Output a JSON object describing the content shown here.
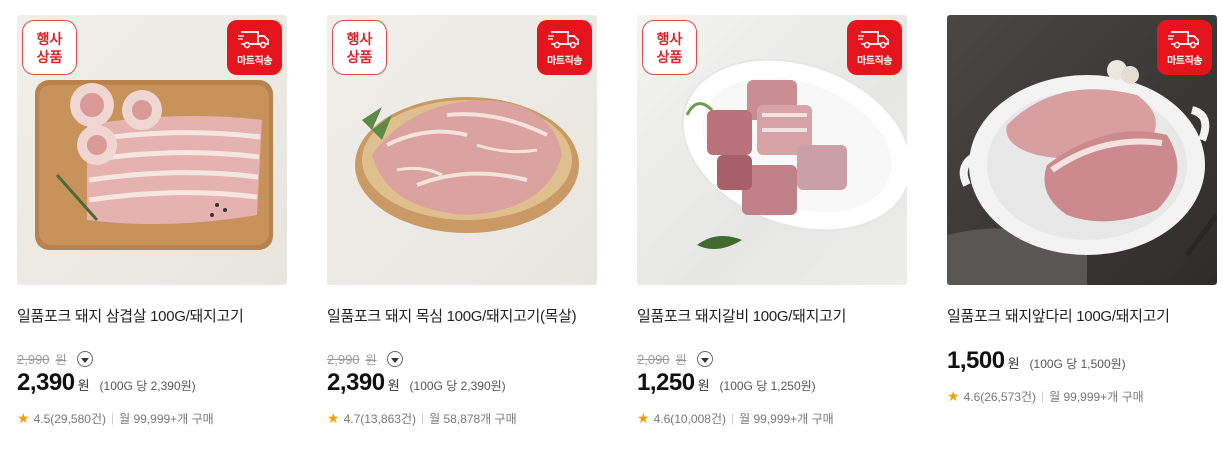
{
  "products": [
    {
      "event_badge": [
        "행사",
        "상품"
      ],
      "delivery_badge": "마트직송",
      "name": "일품포크 돼지 삼겹살 100G/돼지고기",
      "original_price": "2,990",
      "original_unit": "원",
      "price": "2,390",
      "price_unit": "원",
      "unit_price": "(100G 당 2,390원)",
      "rating": "4.5(29,580건)",
      "purchases": "월 99,999+개 구매"
    },
    {
      "event_badge": [
        "행사",
        "상품"
      ],
      "delivery_badge": "마트직송",
      "name": "일품포크 돼지 목심 100G/돼지고기(목살)",
      "original_price": "2,990",
      "original_unit": "원",
      "price": "2,390",
      "price_unit": "원",
      "unit_price": "(100G 당 2,390원)",
      "rating": "4.7(13,863건)",
      "purchases": "월 58,878개 구매"
    },
    {
      "event_badge": [
        "행사",
        "상품"
      ],
      "delivery_badge": "마트직송",
      "name": "일품포크 돼지갈비 100G/돼지고기",
      "original_price": "2,090",
      "original_unit": "원",
      "price": "1,250",
      "price_unit": "원",
      "unit_price": "(100G 당 1,250원)",
      "rating": "4.6(10,008건)",
      "purchases": "월 99,999+개 구매"
    },
    {
      "delivery_badge": "마트직송",
      "name": "일품포크 돼지앞다리 100G/돼지고기",
      "price": "1,500",
      "price_unit": "원",
      "unit_price": "(100G 당 1,500원)",
      "rating": "4.6(26,573건)",
      "purchases": "월 99,999+개 구매"
    }
  ],
  "colors": {
    "delivery_red": "#e6151d",
    "event_red": "#d8262f",
    "star": "#f2a100"
  },
  "icons": [
    "truck-icon",
    "star-icon",
    "chevron-down-icon"
  ]
}
